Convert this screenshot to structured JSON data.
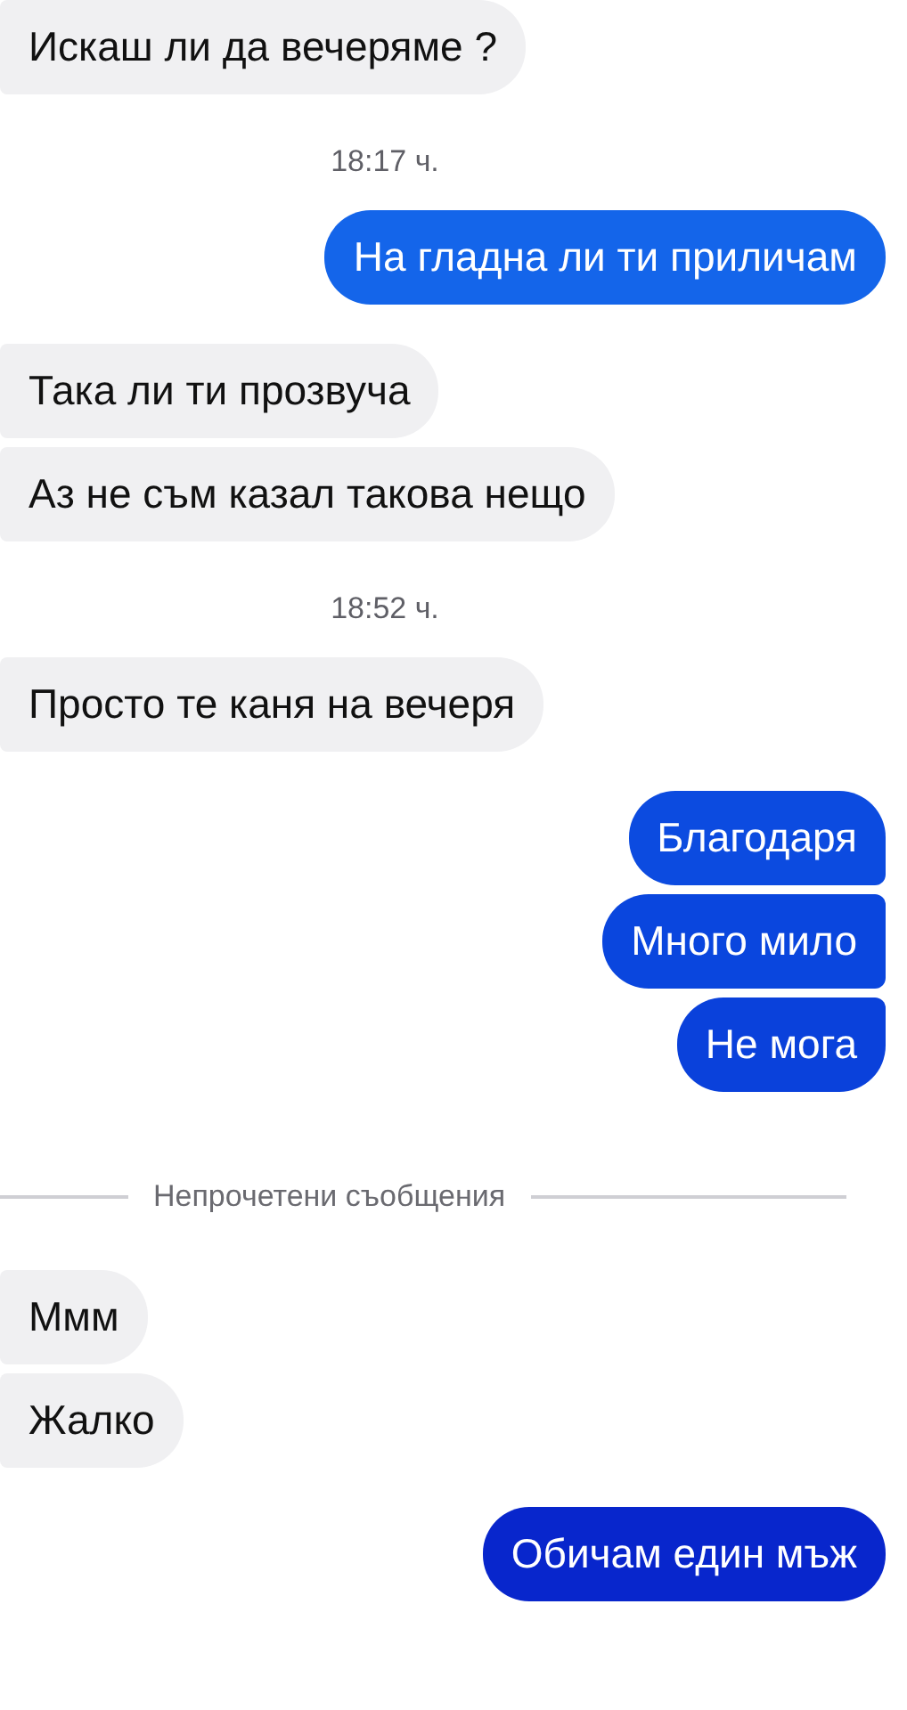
{
  "conversation": [
    {
      "kind": "message",
      "outgoing": false,
      "text": "Искаш ли да вечеряме ?"
    },
    {
      "kind": "time",
      "text": "18:17 ч."
    },
    {
      "kind": "message",
      "outgoing": true,
      "text": "На гладна ли ти приличам"
    },
    {
      "kind": "message",
      "outgoing": false,
      "text": "Така ли ти прозвуча"
    },
    {
      "kind": "message",
      "outgoing": false,
      "text": "Аз не съм казал такова нещо"
    },
    {
      "kind": "time",
      "text": "18:52 ч."
    },
    {
      "kind": "message",
      "outgoing": false,
      "text": "Просто те каня на вечеря"
    },
    {
      "kind": "message",
      "outgoing": true,
      "text": "Благодаря"
    },
    {
      "kind": "message",
      "outgoing": true,
      "text": "Много мило"
    },
    {
      "kind": "message",
      "outgoing": true,
      "text": "Не мога"
    },
    {
      "kind": "divider",
      "text": "Непрочетени съобщения"
    },
    {
      "kind": "message",
      "outgoing": false,
      "text": "Ммм"
    },
    {
      "kind": "message",
      "outgoing": false,
      "text": "Жалко"
    },
    {
      "kind": "message",
      "outgoing": true,
      "text": "Обичам един мъж"
    }
  ]
}
